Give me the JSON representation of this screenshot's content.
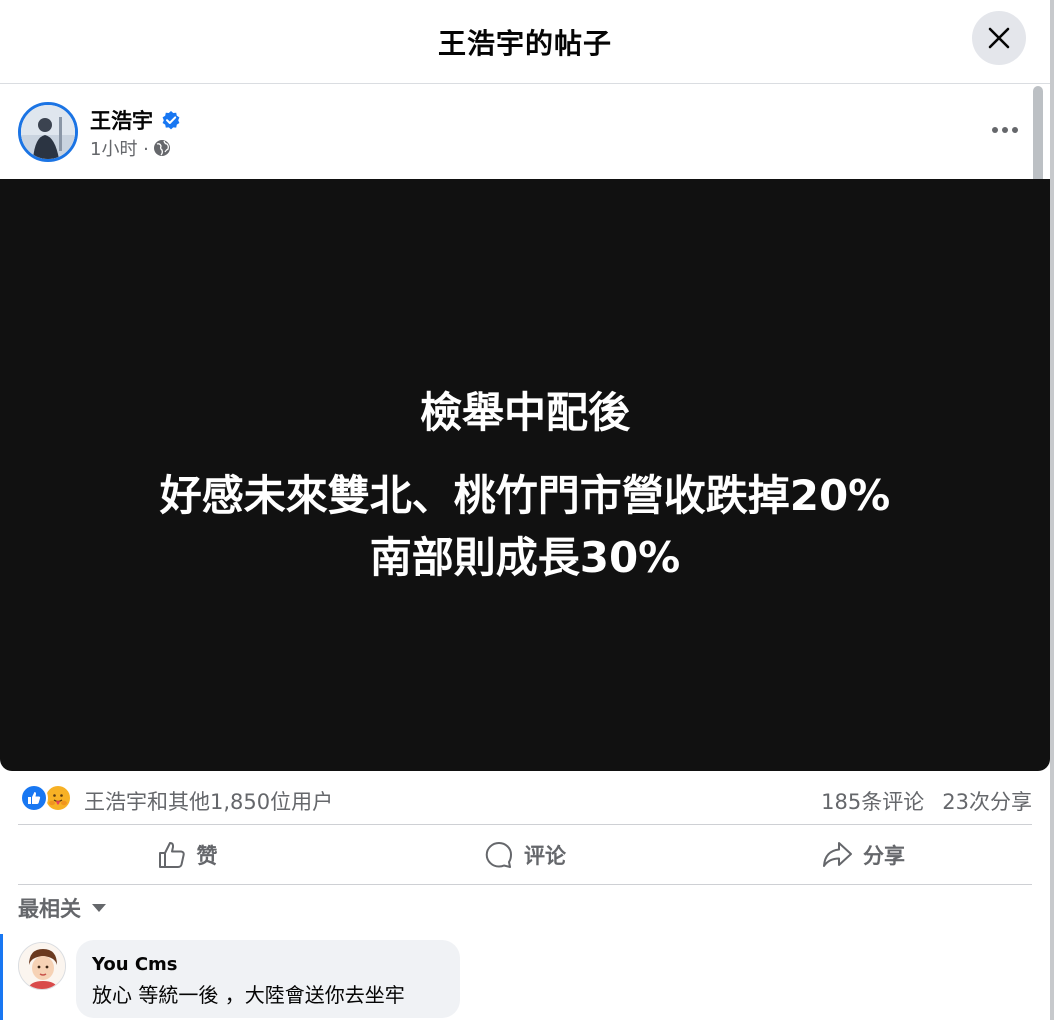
{
  "dialog": {
    "title": "王浩宇的帖子",
    "close_icon": "close-icon"
  },
  "post": {
    "author": "王浩宇",
    "verified_icon": "verified-badge-icon",
    "time": "1小时 ·",
    "audience_icon": "globe-icon",
    "more_icon": "more-options-icon",
    "image_text": {
      "line1": "檢舉中配後",
      "line2": "好感未來雙北、桃竹門市營收跌掉20%",
      "line3": "南部則成長30%"
    },
    "reactors": "王浩宇和其他1,850位用户",
    "comments_count": "185条评论",
    "shares_count": "23次分享"
  },
  "actions": {
    "like": "赞",
    "comment": "评论",
    "share": "分享"
  },
  "sort": {
    "label": "最相关"
  },
  "comments": [
    {
      "author": "You Cms",
      "text": "放心 等統一後 ，大陸會送你去坐牢"
    }
  ],
  "colors": {
    "accent": "#1877f2",
    "image_bg": "#111111",
    "muted_text": "#65676b",
    "bubble_bg": "#f0f2f5"
  }
}
